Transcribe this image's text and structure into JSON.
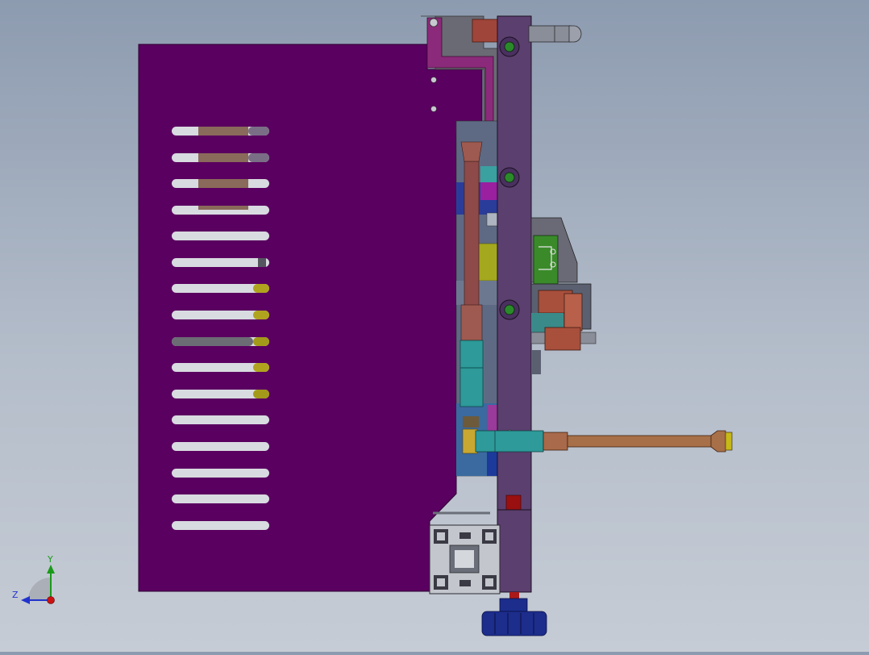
{
  "view": {
    "background_top": "#8d9bb0",
    "background_bottom": "#c6ccd5"
  },
  "model": {
    "panel_color": "#5a0060",
    "frame_color": "#5b3f6e",
    "copper_color": "#a8503c",
    "teal_color": "#2e9a9a",
    "olive_color": "#a49a1a",
    "blue_color": "#1c2d8c",
    "extrusion_color": "#c3c6cc"
  },
  "triad": {
    "y_label": "Y",
    "z_label": "Z",
    "y_color": "#1a9a1a",
    "z_color": "#2233cc",
    "x_color": "#cc1111"
  }
}
